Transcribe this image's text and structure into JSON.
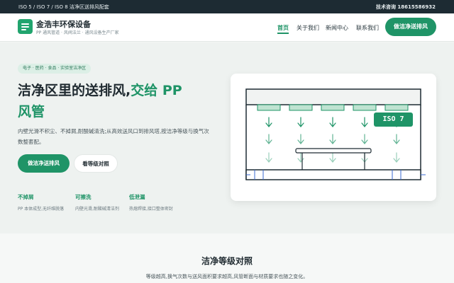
{
  "topbar": {
    "left_text": "ISO 5 / ISO 7 / ISO 8 洁净区送排风配套",
    "right_text": "技术咨询  18615586932"
  },
  "header": {
    "brand": "金浩丰环保设备",
    "tagline": "PP 通风管道 · 风阀法兰 · 通风设备生产厂家",
    "nav": [
      {
        "label": "首页",
        "active": true
      },
      {
        "label": "关于我们",
        "active": false
      },
      {
        "label": "新闻中心",
        "active": false
      },
      {
        "label": "联系我们",
        "active": false
      }
    ],
    "cta": "做洁净送排风"
  },
  "hero": {
    "pill": "电子 · 医药 · 食品 · 实验室洁净区",
    "title_line1": "洁净区里的送排风,",
    "title_highlight1": "交给 PP",
    "title_highlight2": "风管",
    "description": "内壁光滑不积尘、不掉屑,耐酸碱清洗;从高效送风口到排风塔,按洁净等级与换气次数整套配。",
    "primary_button": "做洁净送排风",
    "secondary_button": "看等级对照",
    "features": [
      {
        "title": "不掉屑",
        "desc": "PP 本体成型,无纤维脱落"
      },
      {
        "title": "可擦洗",
        "desc": "内壁光滑,耐酸碱清洁剂"
      },
      {
        "title": "低泄漏",
        "desc": "热熔焊接,接口整体密封"
      }
    ],
    "iso_badge": "ISO 7"
  },
  "section": {
    "title": "洁净等级对照",
    "description": "等级越高,换气次数与送风面积要求越高,风管断面与材质要求也随之变化。"
  },
  "colors": {
    "accent": "#1f9467",
    "dark": "#1d2b33",
    "filter": "#bfe3d1"
  }
}
